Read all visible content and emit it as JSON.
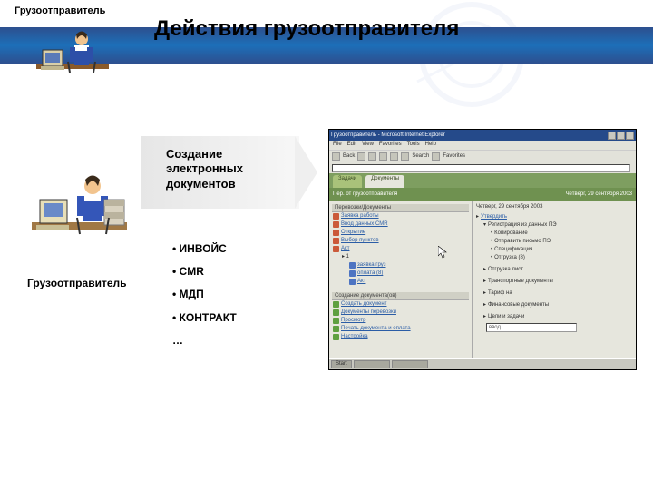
{
  "header": {
    "shipper_label": "Грузоотправитель",
    "title": "Действия грузоотправителя"
  },
  "arrow": {
    "line1": "Создание",
    "line2": "электронных",
    "line3": "документов"
  },
  "shipper_label_mid": "Грузоотправитель",
  "bullets": {
    "b1": "• ИНВОЙС",
    "b2": "• CMR",
    "b3": "• МДП",
    "b4": "• КОНТРАКТ",
    "b5": "…"
  },
  "screenshot": {
    "titlebar": "Грузоотправитель - Microsoft Internet Explorer",
    "menu": {
      "file": "File",
      "edit": "Edit",
      "view": "View",
      "fav": "Favorites",
      "tools": "Tools",
      "help": "Help"
    },
    "toolbar": {
      "back": "Back",
      "search": "Search",
      "fav": "Favorites"
    },
    "tab1": "Задачи",
    "tab2": "Документы",
    "header2_left": "Пер. от грузоотправителя",
    "header2_right": "Четверг, 29 сентября 2003",
    "left_group1": "Перевозки/Документы",
    "left_items1": [
      "Заявка работы",
      "Ввод данных CMR",
      "Открытие",
      "Выбор пунктов",
      "Акт"
    ],
    "left_sub": [
      "заявка груз",
      "оплата (8)",
      "Акт"
    ],
    "left_group2": "Создание документа(ов)",
    "left_items2": [
      "Создать документ",
      "Документы перевозки",
      "Просмотр",
      "Печать документа и оплата",
      "Настройка"
    ],
    "right_head": "Четверг, 29 сентября 2003",
    "right_label1": "Утвердить",
    "right_items1": [
      "Регистрация из данных ПЭ",
      "Копирование",
      "Отправить письмо ПЭ",
      "Спецификация",
      "Отгрузка (8)"
    ],
    "right_items2": [
      "Отгрузка лист",
      "Транспортные документы",
      "Тариф на",
      "Финансовые документы",
      "Цели и задачи"
    ],
    "input_placeholder": "ввод"
  }
}
